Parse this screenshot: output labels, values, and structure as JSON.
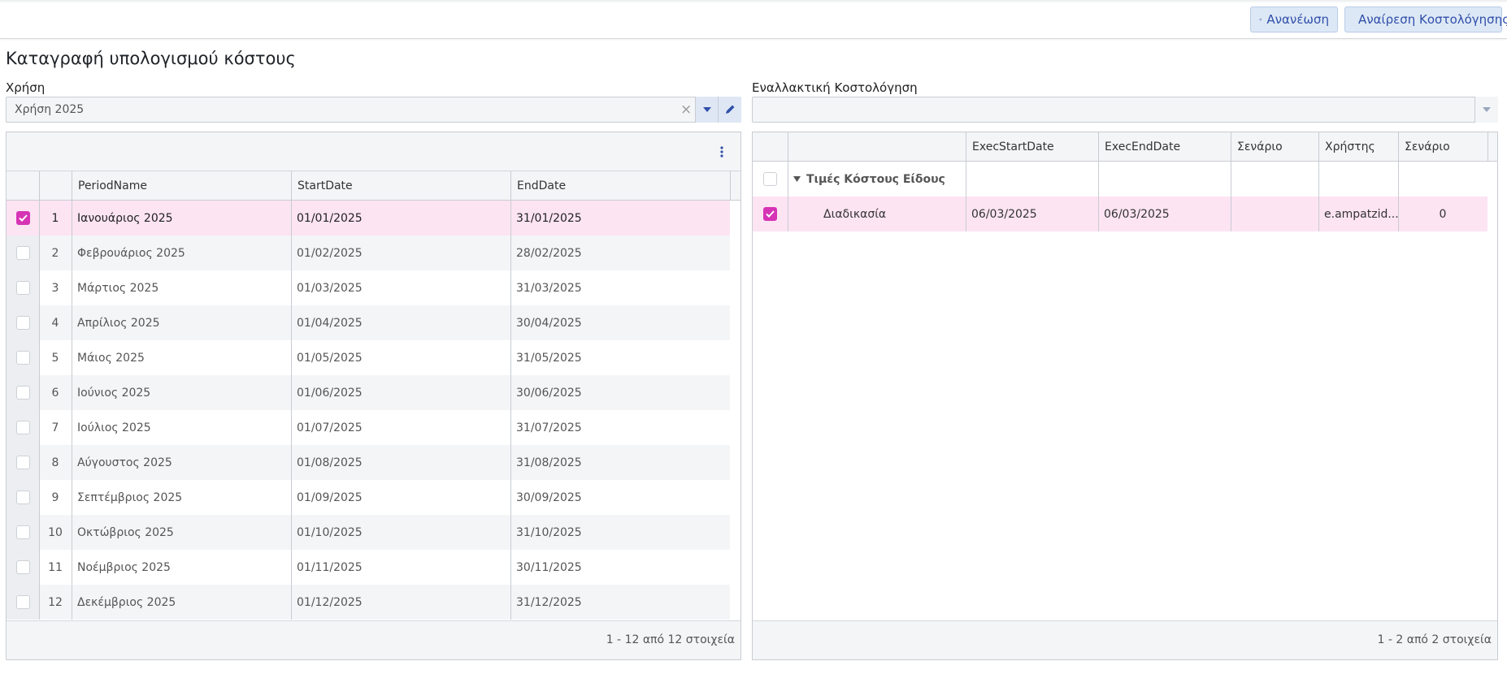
{
  "toolbar": {
    "refresh_label": "Ανανέωση",
    "remove_costing_label": "Αναίρεση Κοστολόγησης"
  },
  "page": {
    "title": "Καταγραφή υπολογισμού κόστους"
  },
  "left": {
    "field_label": "Χρήση",
    "field_value": "Χρήση 2025",
    "clear_glyph": "×",
    "columns": [
      "PeriodName",
      "StartDate",
      "EndDate"
    ],
    "rows": [
      {
        "n": "1",
        "name": "Ιανουάριος 2025",
        "start": "01/01/2025",
        "end": "31/01/2025",
        "checked": true
      },
      {
        "n": "2",
        "name": "Φεβρουάριος 2025",
        "start": "01/02/2025",
        "end": "28/02/2025",
        "checked": false
      },
      {
        "n": "3",
        "name": "Μάρτιος 2025",
        "start": "01/03/2025",
        "end": "31/03/2025",
        "checked": false
      },
      {
        "n": "4",
        "name": "Απρίλιος 2025",
        "start": "01/04/2025",
        "end": "30/04/2025",
        "checked": false
      },
      {
        "n": "5",
        "name": "Μάιος 2025",
        "start": "01/05/2025",
        "end": "31/05/2025",
        "checked": false
      },
      {
        "n": "6",
        "name": "Ιούνιος 2025",
        "start": "01/06/2025",
        "end": "30/06/2025",
        "checked": false
      },
      {
        "n": "7",
        "name": "Ιούλιος 2025",
        "start": "01/07/2025",
        "end": "31/07/2025",
        "checked": false
      },
      {
        "n": "8",
        "name": "Αύγουστος 2025",
        "start": "01/08/2025",
        "end": "31/08/2025",
        "checked": false
      },
      {
        "n": "9",
        "name": "Σεπτέμβριος 2025",
        "start": "01/09/2025",
        "end": "30/09/2025",
        "checked": false
      },
      {
        "n": "10",
        "name": "Οκτώβριος 2025",
        "start": "01/10/2025",
        "end": "31/10/2025",
        "checked": false
      },
      {
        "n": "11",
        "name": "Νοέμβριος 2025",
        "start": "01/11/2025",
        "end": "30/11/2025",
        "checked": false
      },
      {
        "n": "12",
        "name": "Δεκέμβριος 2025",
        "start": "01/12/2025",
        "end": "31/12/2025",
        "checked": false
      }
    ],
    "footer": "1 - 12 από 12 στοιχεία"
  },
  "right": {
    "field_label": "Εναλλακτική Κοστολόγηση",
    "field_value": "",
    "columns": [
      "",
      "ExecStartDate",
      "ExecEndDate",
      "Σενάριο",
      "Χρήστης",
      "Σενάριο"
    ],
    "group": {
      "label": "Τιμές Κόστους Είδους"
    },
    "rows": [
      {
        "name": "Διαδικασία",
        "exec_start": "06/03/2025",
        "exec_end": "06/03/2025",
        "scenario": "",
        "user": "e.ampatzid...",
        "scenario2": "0",
        "checked": true
      }
    ],
    "footer": "1 - 2 από 2 στοιχεία"
  },
  "colors": {
    "accent": "#d633b5",
    "selected_row": "#fce4f3",
    "alt_row": "#f4f5f7",
    "button_text": "#2f4fa8"
  },
  "icons": [
    "refresh-icon",
    "play-icon",
    "dropdown-arrow-icon",
    "edit-pencil-icon",
    "more-vertical-icon",
    "check-icon",
    "expand-triangle-icon"
  ]
}
